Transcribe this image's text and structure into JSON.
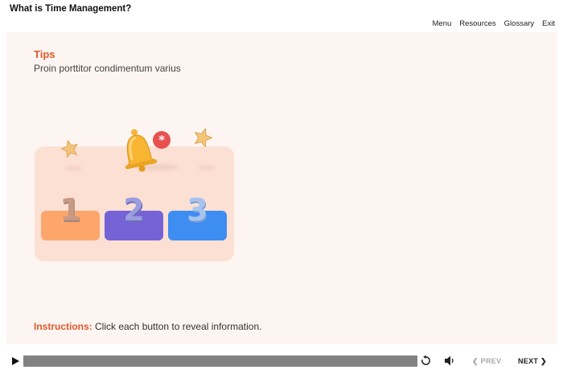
{
  "app": {
    "title": "What is Time Management?"
  },
  "nav": {
    "menu": "Menu",
    "resources": "Resources",
    "glossary": "Glossary",
    "exit": "Exit"
  },
  "slide": {
    "heading": "Tips",
    "subtitle": "Proin porttitor condimentum varius",
    "buttons": [
      {
        "label": "1",
        "color": "#fda66c"
      },
      {
        "label": "2",
        "color": "#7563d6"
      },
      {
        "label": "3",
        "color": "#3d8df2"
      }
    ],
    "badge_icon": "asterisk-icon",
    "instructions_lead": "Instructions:",
    "instructions_text": " Click each button to reveal information."
  },
  "player": {
    "progress": 1.0,
    "prev_label": "PREV",
    "next_label": "NEXT"
  },
  "colors": {
    "accent": "#e1572a",
    "slide_bg": "#fdf5f1",
    "card_bg": "#fde0d4"
  }
}
